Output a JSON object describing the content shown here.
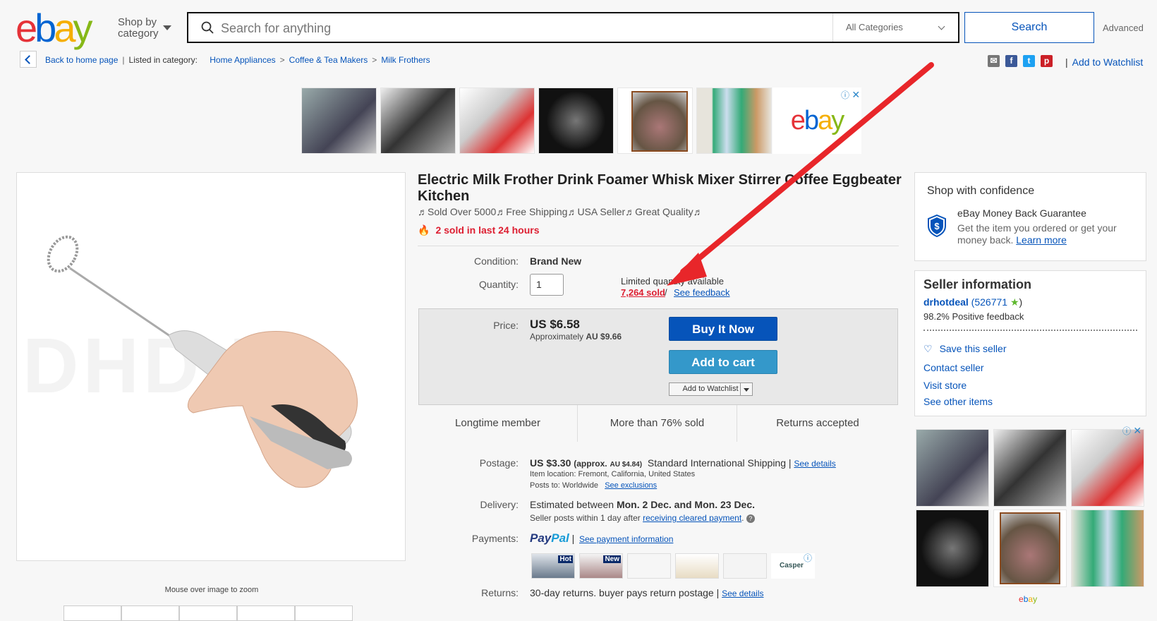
{
  "header": {
    "logo_letters": [
      "e",
      "b",
      "a",
      "y"
    ],
    "shop_by_category": [
      "Shop by",
      "category"
    ],
    "search_placeholder": "Search for anything",
    "category_select": "All Categories",
    "search_button": "Search",
    "advanced_link": "Advanced"
  },
  "breadcrumb": {
    "back_label": "Back to home page",
    "listed_in": "Listed in category:",
    "items": [
      "Home Appliances",
      "Coffee & Tea Makers",
      "Milk Frothers"
    ]
  },
  "share": {
    "watchlist_link": "Add to Watchlist"
  },
  "ad_banner": {
    "brand": "ebay"
  },
  "image": {
    "zoom_hint": "Mouse over image to zoom",
    "watermark": "DHD    K"
  },
  "item": {
    "title": "Electric Milk Frother Drink Foamer Whisk Mixer Stirrer Coffee Eggbeater Kitchen",
    "subtitle": "♬Sold Over 5000♬Free Shipping♬USA Seller♬Great Quality♬",
    "sold_recent": "2 sold in last 24 hours",
    "condition_label": "Condition:",
    "condition_value": "Brand New",
    "quantity_label": "Quantity:",
    "quantity_value": "1",
    "limited": "Limited quantity available",
    "sold_count": "7,264 sold",
    "slash": "/",
    "see_feedback": "See feedback",
    "price_label": "Price:",
    "price": "US $6.58",
    "approx_prefix": "Approximately",
    "approx_value": "AU $9.66",
    "buy_now": "Buy It Now",
    "add_to_cart": "Add to cart",
    "add_to_watchlist": "Add to Watchlist",
    "badges": [
      "Longtime member",
      "More than 76% sold",
      "Returns accepted"
    ]
  },
  "details": {
    "postage_label": "Postage:",
    "postage_price": "US $3.30",
    "postage_approx": "(approx.",
    "postage_approx_val": "AU $4.84)",
    "postage_method": "Standard International Shipping |",
    "postage_see_details": "See details",
    "item_location": "Item location:  Fremont, California, United States",
    "posts_to": "Posts to:  Worldwide",
    "see_exclusions": "See exclusions",
    "delivery_label": "Delivery:",
    "delivery_prefix": "Estimated between",
    "delivery_dates": "Mon. 2 Dec. and Mon. 23 Dec.",
    "seller_posts": "Seller posts within 1 day after",
    "receiving_cleared": "receiving cleared payment",
    "payments_label": "Payments:",
    "paypal_pay": "Pay",
    "paypal_pal": "Pal",
    "payment_info": "See payment information",
    "returns_label": "Returns:",
    "returns_text": "30-day returns. buyer pays return postage |",
    "returns_see": "See details",
    "pay_ad_tags": [
      "Hot",
      "New"
    ],
    "pay_ad_brand": "Casper"
  },
  "confidence": {
    "heading": "Shop with confidence",
    "guarantee": "eBay Money Back Guarantee",
    "guarantee_desc": "Get the item you ordered or get your money back.",
    "learn_more": "Learn more"
  },
  "seller": {
    "heading": "Seller information",
    "name": "drhotdeal",
    "score": "(526771",
    "score_close": ")",
    "positive": "98.2% Positive feedback",
    "save": "Save this seller",
    "contact": "Contact seller",
    "visit": "Visit store",
    "other": "See other items"
  },
  "side_ad": {
    "brand": "ebay"
  },
  "colors": {
    "accent": "#0654ba",
    "buy_now": "#0654ba",
    "add_to_cart": "#3498ca",
    "alert_red": "#dd1e31",
    "annotation_arrow": "#e8262a"
  }
}
